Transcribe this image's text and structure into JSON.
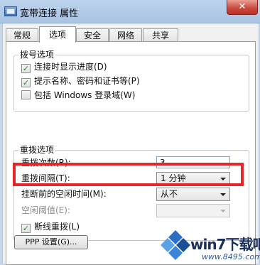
{
  "window": {
    "title": "宽带连接 属性",
    "close_label": "✕"
  },
  "tabs": [
    {
      "label": "常规",
      "active": false
    },
    {
      "label": "选项",
      "active": true
    },
    {
      "label": "安全",
      "active": false
    },
    {
      "label": "网络",
      "active": false
    },
    {
      "label": "共享",
      "active": false
    }
  ],
  "dial_options": {
    "title": "拨号选项",
    "items": [
      {
        "label": "连接时显示进度(D)",
        "checked": true
      },
      {
        "label": "提示名称、密码和证书等(P)",
        "checked": true
      },
      {
        "label": "包括 Windows 登录域(W)",
        "checked": false
      }
    ]
  },
  "redial_options": {
    "title": "重拨选项",
    "redial_attempts": {
      "label": "重拨次数(R):",
      "value": "3"
    },
    "redial_interval": {
      "label": "重拨间隔(T):",
      "value": "1 分钟"
    },
    "idle_hangup": {
      "label": "挂断前的空闲时间(M):",
      "value": "从不"
    },
    "idle_threshold": {
      "label": "空闲阈值(E):",
      "value": ""
    },
    "redial_on_drop": {
      "label": "断线重拨(L)",
      "checked": true
    }
  },
  "ppp_button": {
    "label": "PPP 设置(G)..."
  },
  "highlight_color": "#e5262b",
  "watermark": {
    "brand": "win7下载吧",
    "url": "www.8495.com"
  }
}
